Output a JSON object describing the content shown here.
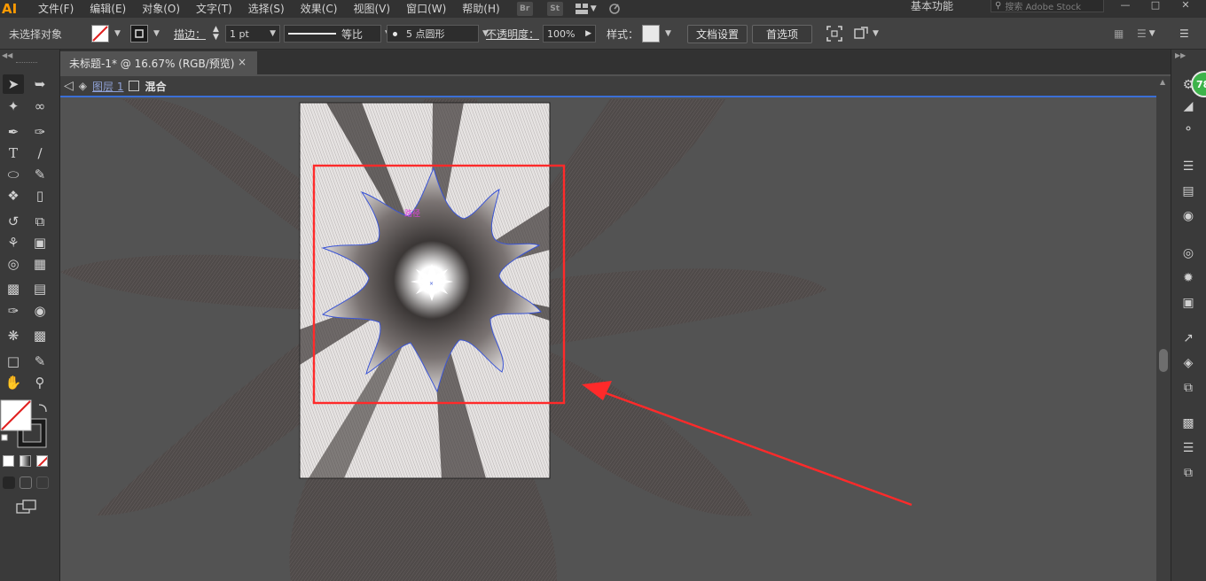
{
  "menubar": {
    "logo": "AI",
    "items": [
      "文件(F)",
      "编辑(E)",
      "对象(O)",
      "文字(T)",
      "选择(S)",
      "效果(C)",
      "视图(V)",
      "窗口(W)",
      "帮助(H)"
    ],
    "bridge": "Br",
    "stock": "St",
    "workspace": "基本功能",
    "search_placeholder": "搜索 Adobe Stock"
  },
  "controlbar": {
    "selection_status": "未选择对象",
    "stroke_label": "描边：",
    "stroke_weight": "1 pt",
    "stroke_profile": "等比",
    "brush": "5 点圆形",
    "opacity_label": "不透明度：",
    "opacity_value": "100%",
    "style_label": "样式：",
    "doc_setup_button": "文档设置",
    "preferences_button": "首选项"
  },
  "tab": {
    "title": "未标题-1* @ 16.67% (RGB/预览)",
    "close": "×"
  },
  "breadcrumb": {
    "layer": "图层 1",
    "object": "混合"
  },
  "canvas": {
    "anchor_label": "路径",
    "colors": {
      "pasteboard": "#535353",
      "artboard": "#f2f2f2",
      "selection_box": "#ff2a2a",
      "arrow": "#ff2a2a",
      "path_highlight": "#3b55d6"
    }
  },
  "right_panel": {
    "badge": "78"
  },
  "icons": {
    "left_tools": [
      "selection-icon",
      "direct-selection-icon",
      "magic-wand-icon",
      "lasso-icon",
      "pen-icon",
      "curvature-icon",
      "type-icon",
      "line-icon",
      "ellipse-icon",
      "paintbrush-icon",
      "shaper-icon",
      "eraser-icon",
      "rotate-icon",
      "scale-icon",
      "width-icon",
      "free-transform-icon",
      "shape-builder-icon",
      "perspective-grid-icon",
      "mesh-icon",
      "gradient-icon",
      "eyedropper-icon",
      "blend-icon",
      "symbol-sprayer-icon",
      "column-graph-icon",
      "artboard-icon",
      "slice-icon",
      "hand-icon",
      "zoom-icon"
    ]
  }
}
